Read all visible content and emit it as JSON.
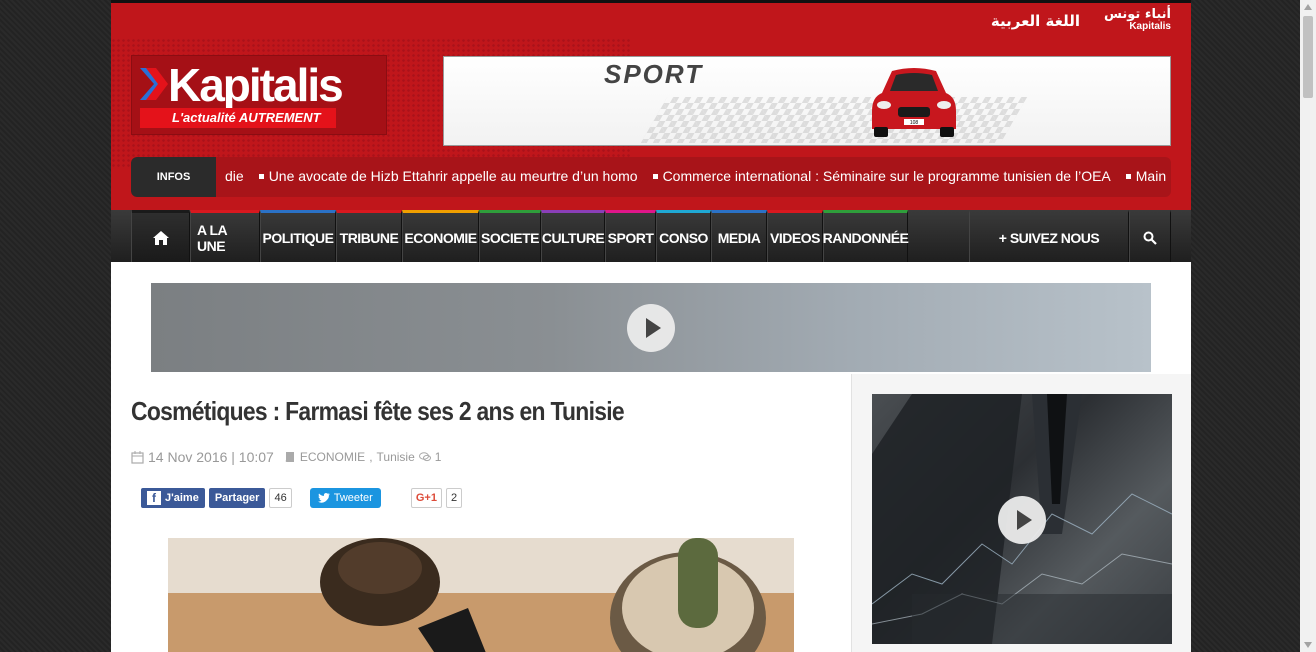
{
  "header": {
    "arabic_link": "اللغة العربية",
    "arabic_logo": "أنباء تونس",
    "arabic_logo_sub": "Kapitalis",
    "logo": {
      "name": "Kapitalis",
      "tagline_a": "L'actualité",
      "tagline_b": "AUTREMENT"
    },
    "banner": {
      "text": "SPORT",
      "plate": "108"
    },
    "colors": {
      "brand_red": "#c0161b"
    }
  },
  "ticker": {
    "label": "INFOS",
    "items": [
      "die",
      "Une avocate de Hizb Ettahrir appelle au meurtre d’un homo",
      "Commerce international : Séminaire sur le programme tunisien de l’OEA",
      "Main"
    ]
  },
  "nav": {
    "home_icon": "home-icon",
    "items": [
      {
        "label": "A LA UNE",
        "color": "#d9181f"
      },
      {
        "label": "POLITIQUE",
        "color": "#2b72c6"
      },
      {
        "label": "TRIBUNE",
        "color": "#d9181f"
      },
      {
        "label": "ECONOMIE",
        "color": "#f0a000"
      },
      {
        "label": "SOCIETE",
        "color": "#2f9e3b"
      },
      {
        "label": "CULTURE",
        "color": "#8a3fb8"
      },
      {
        "label": "SPORT",
        "color": "#e0168a"
      },
      {
        "label": "CONSO",
        "color": "#1fa9d4"
      },
      {
        "label": "MEDIA",
        "color": "#2b72c6"
      },
      {
        "label": "VIDEOS",
        "color": "#d9181f"
      },
      {
        "label": "RANDONNÉE",
        "color": "#2f9e3b"
      }
    ],
    "follow": "+ SUIVEZ NOUS",
    "search_icon": "search-icon"
  },
  "article": {
    "title": "Cosmétiques : Farmasi fête ses 2 ans en Tunisie",
    "date": "14 Nov 2016 | 10:07",
    "category": "ECONOMIE",
    "tag": "Tunisie",
    "comments": "1"
  },
  "social": {
    "like": "J'aime",
    "share": "Partager",
    "share_count": "46",
    "tweet": "Tweeter",
    "gplus": "G+1",
    "gplus_count": "2"
  }
}
